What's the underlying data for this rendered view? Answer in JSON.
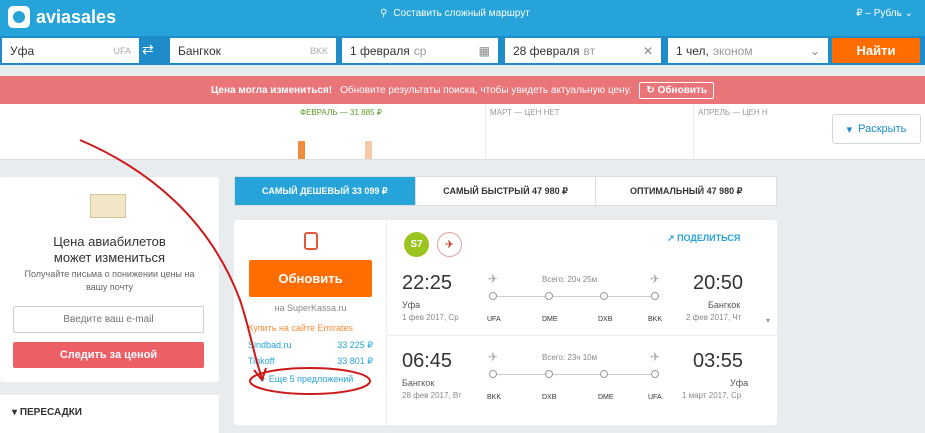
{
  "topbar": {
    "logo": "aviasales",
    "complex_route": "Составить сложный маршрут",
    "currency": "₽ – Рубль"
  },
  "search": {
    "origin": "Уфа",
    "origin_iata": "UFA",
    "destination": "Бангкок",
    "destination_iata": "BKK",
    "depart_date": "1 февраля",
    "depart_day": "ср",
    "return_date": "28 февраля",
    "return_day": "вт",
    "passengers": "1 чел,",
    "class": "эконом",
    "find_label": "Найти"
  },
  "alert": {
    "strong": "Цена могла измениться!",
    "text": "Обновите результаты поиска, чтобы увидеть актуальную цену.",
    "refresh_label": "Обновить"
  },
  "calendar": {
    "months": [
      "ФЕВРАЛЬ — 31 885 ₽",
      "МАРТ — ЦЕН НЕТ",
      "АПРЕЛЬ — ЦЕН Н"
    ],
    "expand_label": "Раскрыть"
  },
  "subscribe": {
    "title_line1": "Цена авиабилетов",
    "title_line2": "может измениться",
    "subtitle": "Получайте письма о понижении цены на вашу почту",
    "email_placeholder": "Введите ваш e-mail",
    "follow_label": "Следить за ценой"
  },
  "filters": {
    "transfers_label": "ПЕРЕСАДКИ"
  },
  "tabs": [
    {
      "label": "САМЫЙ ДЕШЕВЫЙ 33 099 ₽"
    },
    {
      "label": "САМЫЙ БЫСТРЫЙ 47 980 ₽"
    },
    {
      "label": "ОПТИМАЛЬНЫЙ 47 980 ₽"
    }
  ],
  "ticket": {
    "update_label": "Обновить",
    "via": "на SuperKassa.ru",
    "buy_emirates": "Купить на сайте Emirates",
    "offers": [
      {
        "agency": "Sindbad.ru",
        "price": "33 225 ₽"
      },
      {
        "agency": "Tinkoff",
        "price": "33 801 ₽"
      }
    ],
    "more_offers": "+ Еще 5 предложений",
    "s7_logo": "S7",
    "share_label": "ПОДЕЛИТЬСЯ",
    "outbound": {
      "dep_time": "22:25",
      "dep_city": "Уфа",
      "dep_date": "1 фев 2017, Ср",
      "arr_time": "20:50",
      "arr_city": "Бангкок",
      "arr_date": "2 фев 2017, Чт",
      "duration": "Всего: 20ч 25м",
      "airports": [
        "UFA",
        "DME",
        "DXB",
        "BKK"
      ]
    },
    "inbound": {
      "dep_time": "06:45",
      "dep_city": "Бангкок",
      "dep_date": "28 фев 2017, Вт",
      "arr_time": "03:55",
      "arr_city": "Уфа",
      "arr_date": "1 март 2017, Ср",
      "duration": "Всего: 23ч 10м",
      "airports": [
        "BKK",
        "DXB",
        "DME",
        "UFA"
      ]
    }
  },
  "colors": {
    "brand": "#26a3d9",
    "accent": "#ff6d00",
    "alert": "#ea7579",
    "annotation": "#cc1a1a"
  }
}
